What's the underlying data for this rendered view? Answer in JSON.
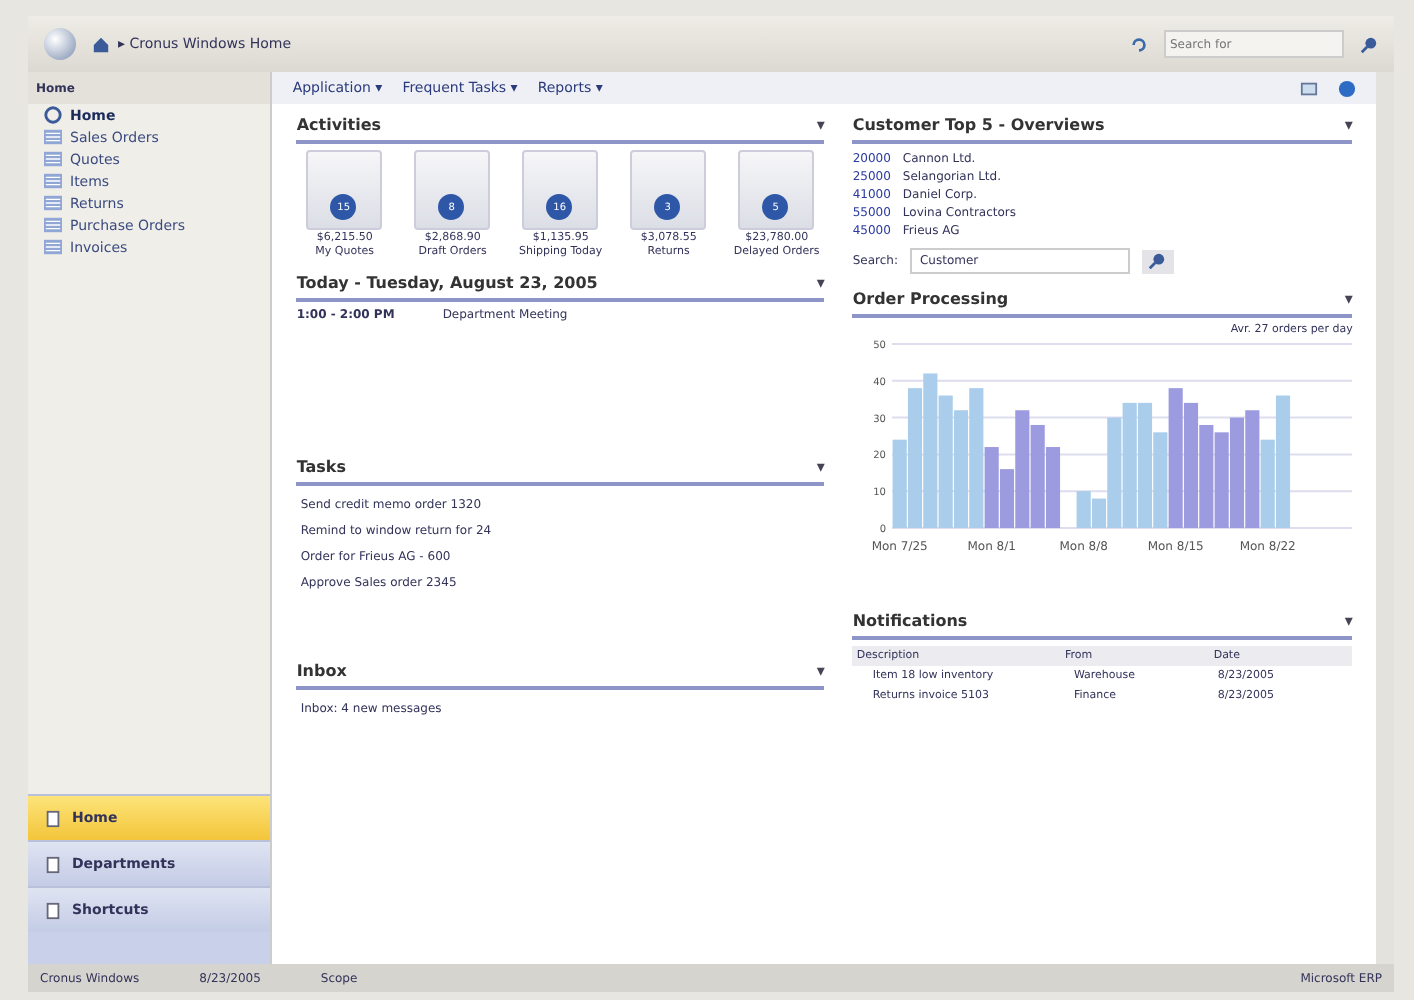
{
  "address_bar": {
    "path": "▸ Cronus Windows Home"
  },
  "search": {
    "placeholder": "Search for"
  },
  "sidebar": {
    "title": "Home",
    "items": [
      {
        "label": "Home",
        "kind": "home",
        "selected": true
      },
      {
        "label": "Sales Orders",
        "kind": "folder",
        "selected": false
      },
      {
        "label": "Quotes",
        "kind": "folder",
        "selected": false
      },
      {
        "label": "Items",
        "kind": "folder",
        "selected": false
      },
      {
        "label": "Returns",
        "kind": "folder",
        "selected": false
      },
      {
        "label": "Purchase Orders",
        "kind": "folder",
        "selected": false
      },
      {
        "label": "Invoices",
        "kind": "folder",
        "selected": false
      }
    ],
    "sections": [
      {
        "label": "Home",
        "selected": true
      },
      {
        "label": "Departments",
        "selected": false
      },
      {
        "label": "Shortcuts",
        "selected": false
      }
    ]
  },
  "toolbar": [
    "Application ▾",
    "Frequent Tasks ▾",
    "Reports ▾"
  ],
  "activities": {
    "title": "Activities",
    "toggle": "▾",
    "tiles": [
      {
        "count": "15",
        "amount": "$6,215.50",
        "label": "My Quotes"
      },
      {
        "count": "8",
        "amount": "$2,868.90",
        "label": "Draft Orders"
      },
      {
        "count": "16",
        "amount": "$1,135.95",
        "label": "Shipping Today"
      },
      {
        "count": "3",
        "amount": "$3,078.55",
        "label": "Returns"
      },
      {
        "count": "5",
        "amount": "$23,780.00",
        "label": "Delayed Orders"
      }
    ]
  },
  "today": {
    "title": "Today - Tuesday, August 23, 2005",
    "toggle": "▾",
    "events": [
      {
        "time": "1:00 - 2:00 PM",
        "subject": "Department Meeting"
      }
    ]
  },
  "tasks": {
    "title": "Tasks",
    "toggle": "▾",
    "items": [
      "Send credit memo order 1320",
      "Remind to window return for 24",
      "Order for Frieus AG - 600",
      "Approve Sales order 2345"
    ]
  },
  "inbox": {
    "title": "Inbox",
    "toggle": "▾",
    "text": "Inbox: 4 new messages"
  },
  "customers": {
    "title": "Customer Top 5 - Overviews",
    "toggle": "▾",
    "rows": [
      {
        "number": "20000",
        "name": "Cannon Ltd."
      },
      {
        "number": "25000",
        "name": "Selangorian Ltd."
      },
      {
        "number": "41000",
        "name": "Daniel Corp."
      },
      {
        "number": "55000",
        "name": "Lovina Contractors"
      },
      {
        "number": "45000",
        "name": "Frieus AG"
      }
    ],
    "search_label": "Search:",
    "search_value": "Customer"
  },
  "order_processing": {
    "title": "Order Processing",
    "toggle": "▾",
    "note": "Avr. 27 orders per day",
    "chart_data": {
      "type": "bar",
      "categories": [
        "Mon 7/25",
        null,
        null,
        null,
        null,
        null,
        "Mon 8/1",
        null,
        null,
        null,
        null,
        null,
        "Mon 8/8",
        null,
        null,
        null,
        null,
        null,
        "Mon 8/15",
        null,
        null,
        null,
        null,
        null,
        "Mon 8/22",
        null,
        null,
        null,
        null,
        null
      ],
      "series": [
        {
          "color": "#a9cdea",
          "values": [
            24,
            38,
            42,
            36,
            32,
            38,
            null,
            null,
            null,
            null,
            null,
            null,
            10,
            8,
            30,
            34,
            34,
            26,
            null,
            null,
            null,
            null,
            null,
            null,
            24,
            36,
            null,
            null,
            null,
            null
          ]
        },
        {
          "color": "#9d9be0",
          "values": [
            null,
            null,
            null,
            null,
            null,
            null,
            22,
            16,
            32,
            28,
            22,
            null,
            null,
            null,
            null,
            null,
            null,
            null,
            38,
            34,
            28,
            26,
            30,
            32,
            null,
            null,
            null,
            null,
            null,
            null
          ]
        }
      ],
      "ylim": [
        0,
        50
      ],
      "yticks": [
        0,
        10,
        20,
        30,
        40,
        50
      ],
      "grid": true
    }
  },
  "notifications": {
    "title": "Notifications",
    "toggle": "▾",
    "columns": [
      "Description",
      "From",
      "Date"
    ],
    "rows": [
      [
        "Item 18 low inventory",
        "Warehouse",
        "8/23/2005"
      ],
      [
        "Returns invoice 5103",
        "Finance",
        "8/23/2005"
      ]
    ]
  },
  "status_bar": {
    "left": [
      "Cronus Windows",
      "8/23/2005",
      "Scope"
    ],
    "right": "Microsoft ERP"
  }
}
